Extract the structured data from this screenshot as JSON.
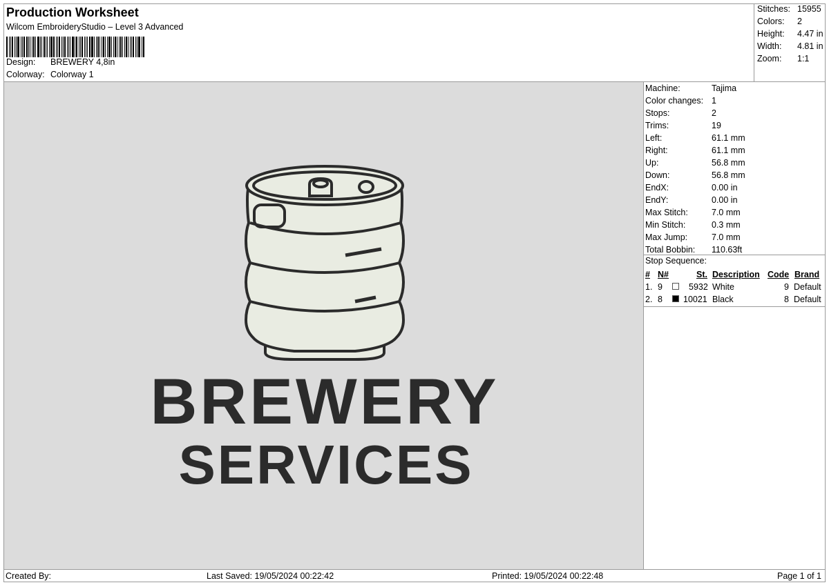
{
  "header": {
    "title": "Production Worksheet",
    "software": "Wilcom EmbroideryStudio – Level 3 Advanced",
    "design_label": "Design:",
    "design_value": "BREWERY 4,8in",
    "colorway_label": "Colorway:",
    "colorway_value": "Colorway 1"
  },
  "stats": [
    {
      "label": "Stitches:",
      "value": "15955"
    },
    {
      "label": "Colors:",
      "value": "2"
    },
    {
      "label": "Height:",
      "value": "4.47 in"
    },
    {
      "label": "Width:",
      "value": "4.81 in"
    },
    {
      "label": "Zoom:",
      "value": "1:1"
    }
  ],
  "design_preview": {
    "line1": "BREWERY",
    "line2": "SERVICES",
    "thread_white": "#e9ece2",
    "thread_black": "#2b2b2b",
    "background": "#dcdcdc"
  },
  "machine_info": [
    {
      "label": "Machine:",
      "value": "Tajima"
    },
    {
      "label": "Color changes:",
      "value": "1"
    },
    {
      "label": "Stops:",
      "value": "2"
    },
    {
      "label": "Trims:",
      "value": "19"
    },
    {
      "label": "Left:",
      "value": "61.1 mm"
    },
    {
      "label": "Right:",
      "value": "61.1 mm"
    },
    {
      "label": "Up:",
      "value": "56.8 mm"
    },
    {
      "label": "Down:",
      "value": "56.8 mm"
    },
    {
      "label": "EndX:",
      "value": "0.00 in"
    },
    {
      "label": "EndY:",
      "value": "0.00 in"
    },
    {
      "label": "Max Stitch:",
      "value": "7.0 mm"
    },
    {
      "label": "Min Stitch:",
      "value": "0.3 mm"
    },
    {
      "label": "Max Jump:",
      "value": "7.0 mm"
    },
    {
      "label": "Total Bobbin:",
      "value": "110.63ft"
    }
  ],
  "stop_sequence": {
    "title": "Stop Sequence:",
    "headers": {
      "num": "#",
      "n": "N#",
      "st": "St.",
      "description": "Description",
      "code": "Code",
      "brand": "Brand"
    },
    "rows": [
      {
        "num": "1.",
        "n": "9",
        "swatch": "#ffffff",
        "st": "5932",
        "description": "White",
        "code": "9",
        "brand": "Default"
      },
      {
        "num": "2.",
        "n": "8",
        "swatch": "#000000",
        "st": "10021",
        "description": "Black",
        "code": "8",
        "brand": "Default"
      }
    ]
  },
  "footer": {
    "created_by": "Created By:",
    "last_saved": "Last Saved: 19/05/2024 00:22:42",
    "printed": "Printed: 19/05/2024 00:22:48",
    "page": "Page 1 of 1"
  }
}
